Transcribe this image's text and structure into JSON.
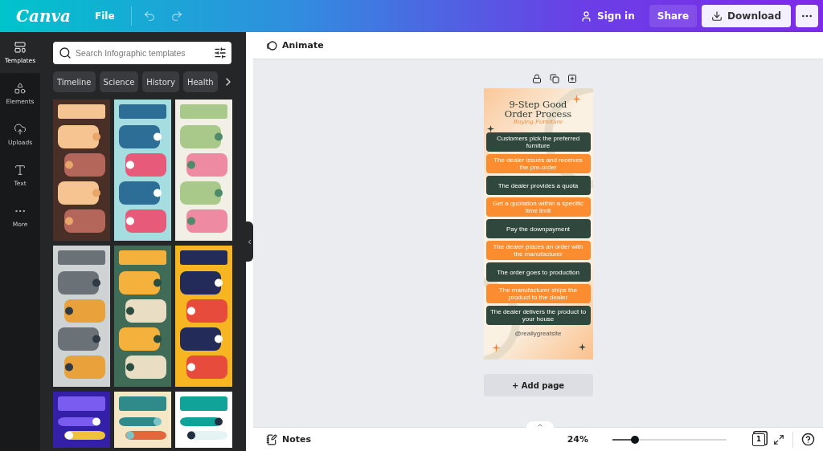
{
  "topbar": {
    "logo": "Canva",
    "menu": "File",
    "sign_in": "Sign in",
    "share": "Share",
    "download": "Download"
  },
  "rail": [
    {
      "label": "Templates",
      "kind": "templates",
      "selected": true
    },
    {
      "label": "Elements",
      "kind": "elements",
      "selected": false
    },
    {
      "label": "Uploads",
      "kind": "uploads",
      "selected": false
    },
    {
      "label": "Text",
      "kind": "text",
      "selected": false
    },
    {
      "label": "More",
      "kind": "more",
      "selected": false
    }
  ],
  "search": {
    "placeholder": "Search Infographic templates"
  },
  "chips": [
    "Timeline",
    "Science",
    "History",
    "Health"
  ],
  "templates": [
    {
      "kind": "picture"
    },
    {
      "kind": "picture"
    },
    {
      "kind": "picture"
    },
    {
      "kind": "picture"
    },
    {
      "kind": "picture"
    },
    {
      "kind": "picture"
    },
    {
      "kind": "picture"
    },
    {
      "kind": "picture"
    },
    {
      "kind": "picture"
    }
  ],
  "toolbar": {
    "animate": "Animate"
  },
  "design": {
    "title": [
      "9-Step Good",
      "Order Process"
    ],
    "subtitle": "Buying Furniture",
    "steps": [
      {
        "text": "Customers pick the preferred furniture",
        "kind": "dark"
      },
      {
        "text": "The dealer issues and receives the pre-order",
        "kind": "orange"
      },
      {
        "text": "The dealer provides a quota",
        "kind": "dark"
      },
      {
        "text": "Get a quotation within a specific time limit",
        "kind": "orange"
      },
      {
        "text": "Pay the downpayment",
        "kind": "dark"
      },
      {
        "text": "The dealer places an order with the manufacturer",
        "kind": "orange"
      },
      {
        "text": "The order goes to production",
        "kind": "dark"
      },
      {
        "text": "The manufacturer ships the product to the dealer",
        "kind": "orange"
      },
      {
        "text": "The dealer delivers the product to your house",
        "kind": "dark"
      }
    ],
    "footer": "@reallygreatsite"
  },
  "add_page": "+ Add page",
  "bottombar": {
    "notes": "Notes",
    "zoom": "24%",
    "level": 0.2,
    "pages": "1"
  }
}
